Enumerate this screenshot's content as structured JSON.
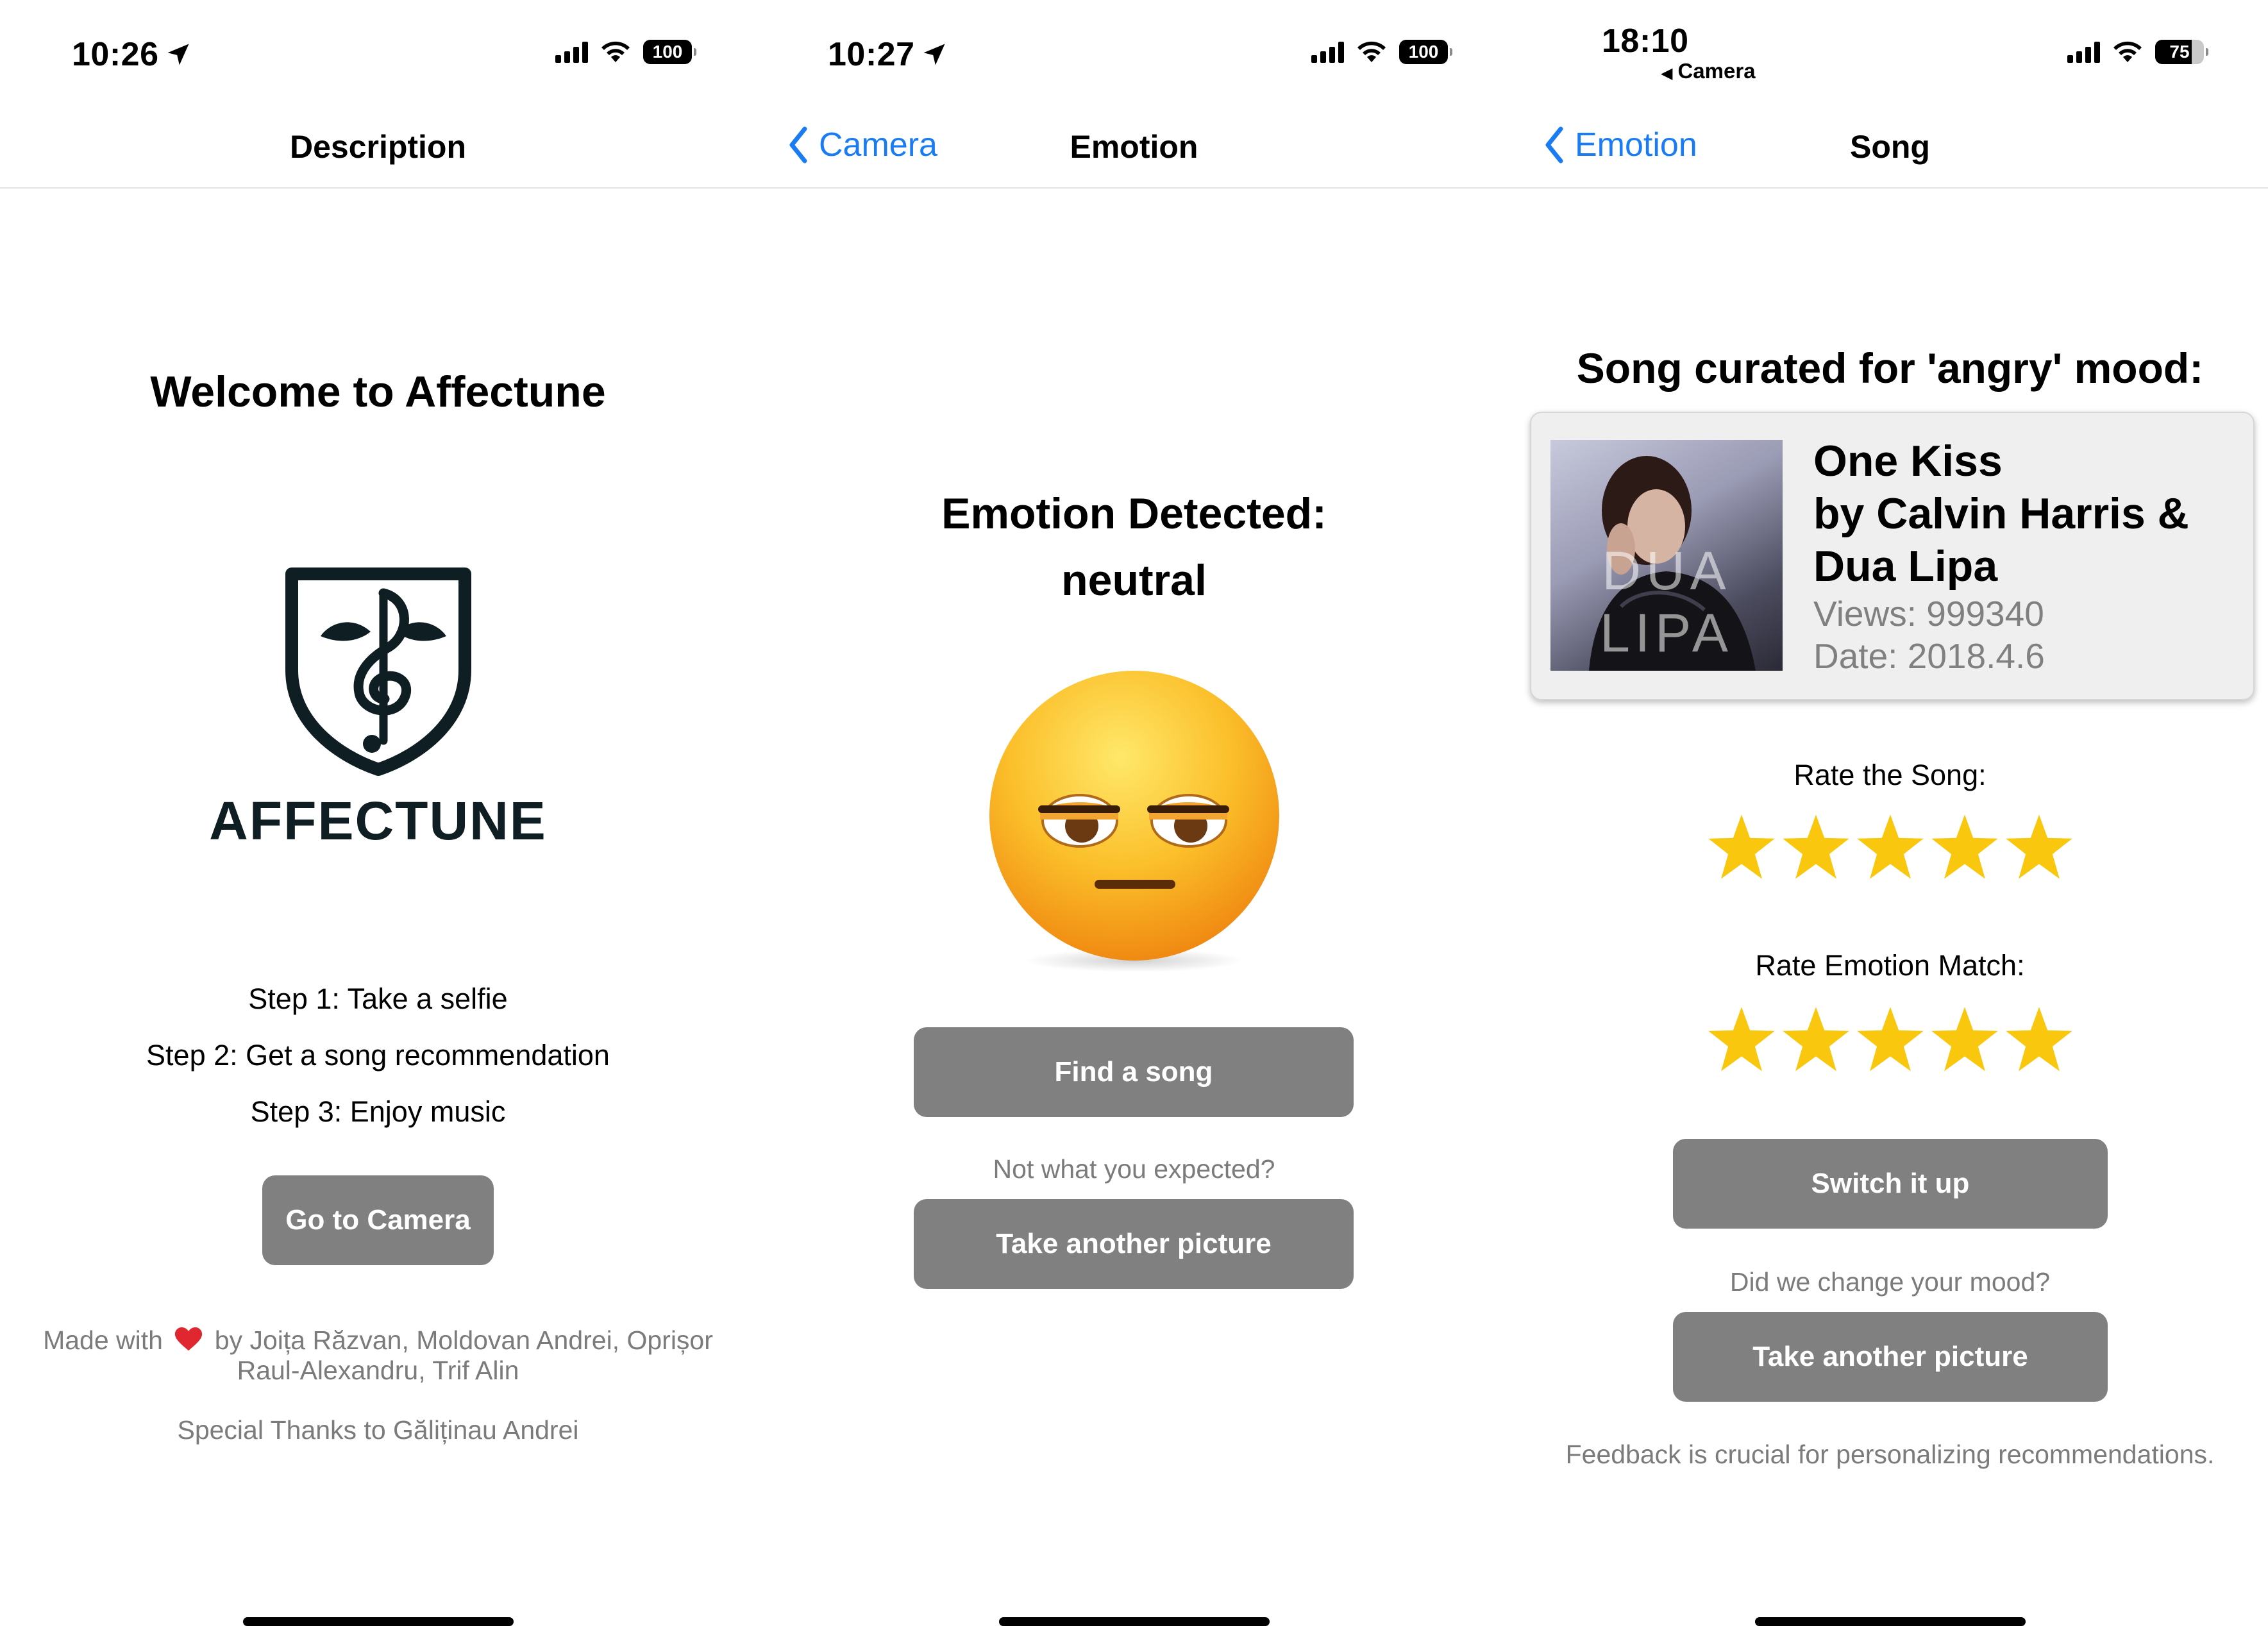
{
  "screens": [
    {
      "status": {
        "time": "10:26",
        "battery": "100"
      },
      "nav": {
        "title": "Description"
      },
      "welcome": "Welcome to Affectune",
      "logo_text": "AFFECTUNE",
      "steps": [
        "Step 1: Take a selfie",
        "Step 2: Get a song recommendation",
        "Step 3: Enjoy music"
      ],
      "button": "Go to Camera",
      "credits_before": "Made with",
      "credits_after": "by Joița Răzvan, Moldovan Andrei, Oprișor",
      "credits_line2": "Raul-Alexandru, Trif Alin",
      "thanks": "Special Thanks to Găliținau Andrei"
    },
    {
      "status": {
        "time": "10:27",
        "battery": "100"
      },
      "nav": {
        "back": "Camera",
        "title": "Emotion"
      },
      "emotion_label": "Emotion Detected:",
      "emotion_value": "neutral",
      "find_button": "Find a song",
      "not_expected": "Not what you expected?",
      "retake_button": "Take another picture"
    },
    {
      "status": {
        "time": "18:10",
        "battery": "75",
        "back_app": "Camera"
      },
      "nav": {
        "back": "Emotion",
        "title": "Song"
      },
      "curated": "Song curated for 'angry' mood:",
      "song": {
        "title": "One Kiss",
        "artist_line1": "by Calvin Harris &",
        "artist_line2": "Dua Lipa",
        "views": "Views: 999340",
        "date": "Date: 2018.4.6",
        "album_text": "DUA LIPA"
      },
      "rate_song_label": "Rate the Song:",
      "rate_song_value": 5,
      "rate_match_label": "Rate Emotion Match:",
      "rate_match_value": 5,
      "switch_button": "Switch it up",
      "mood_question": "Did we change your mood?",
      "retake_button": "Take another picture",
      "feedback": "Feedback is crucial for personalizing recommendations."
    }
  ],
  "colors": {
    "accent": "#1a7cf5",
    "button_bg": "#808080",
    "star": "#f9c80e",
    "logo": "#0e1e23",
    "heart": "#e0262e"
  },
  "icons": [
    "location-arrow-icon",
    "signal-icon",
    "wifi-icon",
    "battery-icon",
    "chevron-left-icon",
    "heart-icon",
    "star-icon",
    "affectune-logo",
    "neutral-face-emoji"
  ]
}
